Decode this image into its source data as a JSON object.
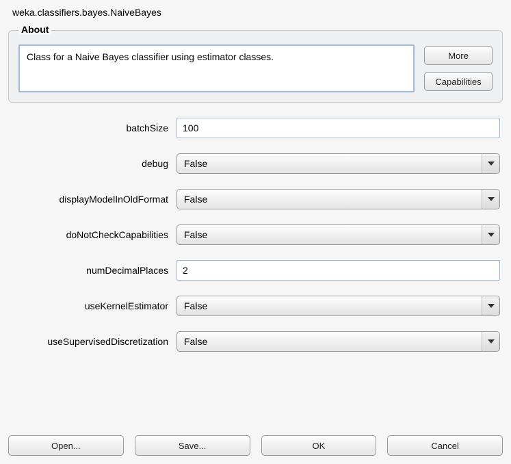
{
  "title": "weka.classifiers.bayes.NaiveBayes",
  "about": {
    "legend": "About",
    "description": "Class for a Naive Bayes classifier using estimator classes.",
    "moreLabel": "More",
    "capabilitiesLabel": "Capabilities"
  },
  "props": {
    "batchSize": {
      "label": "batchSize",
      "value": "100"
    },
    "debug": {
      "label": "debug",
      "value": "False"
    },
    "displayModelInOldFormat": {
      "label": "displayModelInOldFormat",
      "value": "False"
    },
    "doNotCheckCapabilities": {
      "label": "doNotCheckCapabilities",
      "value": "False"
    },
    "numDecimalPlaces": {
      "label": "numDecimalPlaces",
      "value": "2"
    },
    "useKernelEstimator": {
      "label": "useKernelEstimator",
      "value": "False"
    },
    "useSupervisedDiscretization": {
      "label": "useSupervisedDiscretization",
      "value": "False"
    }
  },
  "footer": {
    "open": "Open...",
    "save": "Save...",
    "ok": "OK",
    "cancel": "Cancel"
  }
}
